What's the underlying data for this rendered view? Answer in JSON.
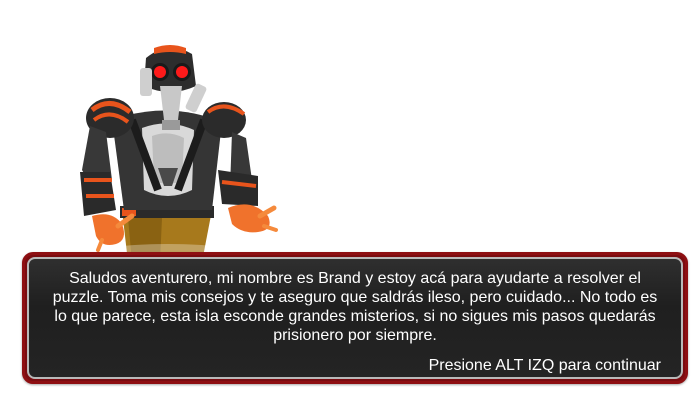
{
  "npc": {
    "name": "Brand",
    "portrait_icon": "gasmask-robot-character",
    "colors": {
      "armor": "#3a3a3a",
      "accent": "#e8541c",
      "eyes": "#ff1a1a",
      "pants": "#b8860b"
    }
  },
  "dialog": {
    "text": "Saludos aventurero, mi nombre es Brand y estoy acá para ayudarte a resolver el puzzle. Toma mis consejos y te aseguro que saldrás ileso, pero cuidado... No todo es lo que parece, esta isla esconde grandes misterios, si no sigues mis pasos quedarás prisionero por siempre.",
    "continue_hint": "Presione ALT IZQ para continuar",
    "border_color": "#8e0f12",
    "background_color": "#252525"
  }
}
